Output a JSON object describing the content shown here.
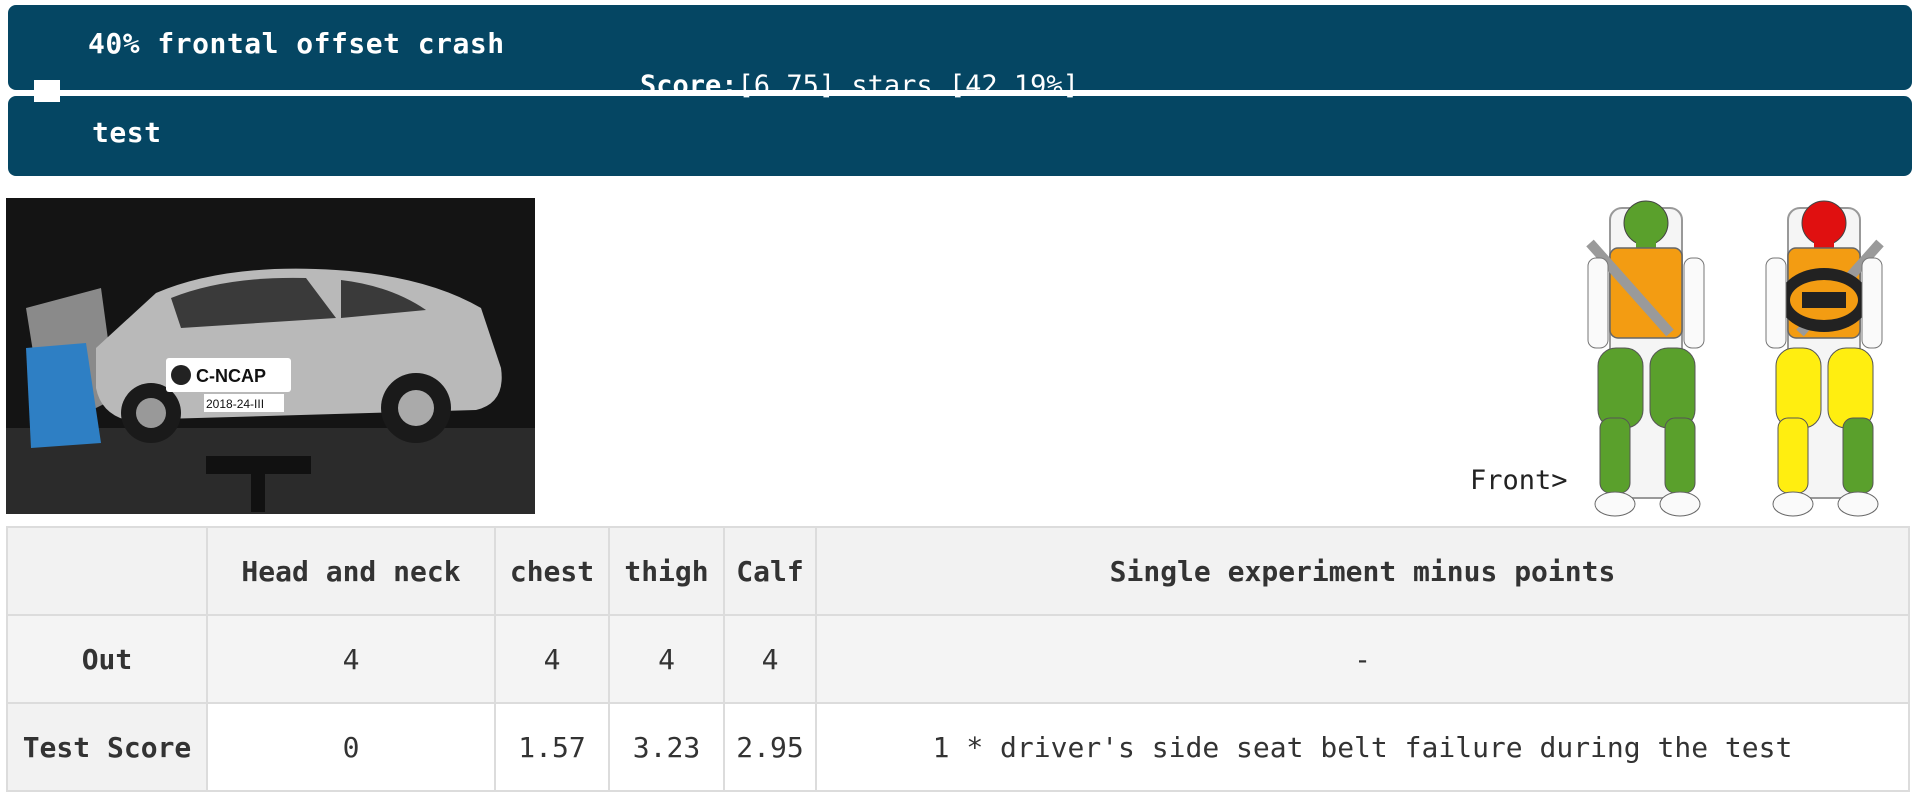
{
  "header": {
    "title": "40% frontal offset crash",
    "score_label": "Score:",
    "score_value": "[6.75] stars [42.19%]"
  },
  "subheader": {
    "title": "test"
  },
  "photo": {
    "alt": "C-NCAP crash test photo",
    "badge": "C-NCAP",
    "plate": "2018-24-III"
  },
  "figure": {
    "front_label": "Front>",
    "colors": {
      "green": "#5aa02c",
      "red": "#e01010",
      "orange": "#f39c12",
      "yellow": "#ffee10"
    }
  },
  "table": {
    "columns": [
      "",
      "Head and neck",
      "chest",
      "thigh",
      "Calf",
      "Single experiment minus points"
    ],
    "rows": [
      {
        "label": "Out",
        "cells": [
          "4",
          "4",
          "4",
          "4",
          "-"
        ]
      },
      {
        "label": "Test Score",
        "cells": [
          "0",
          "1.57",
          "3.23",
          "2.95",
          "1 * driver's side seat belt failure during the test"
        ]
      }
    ]
  }
}
